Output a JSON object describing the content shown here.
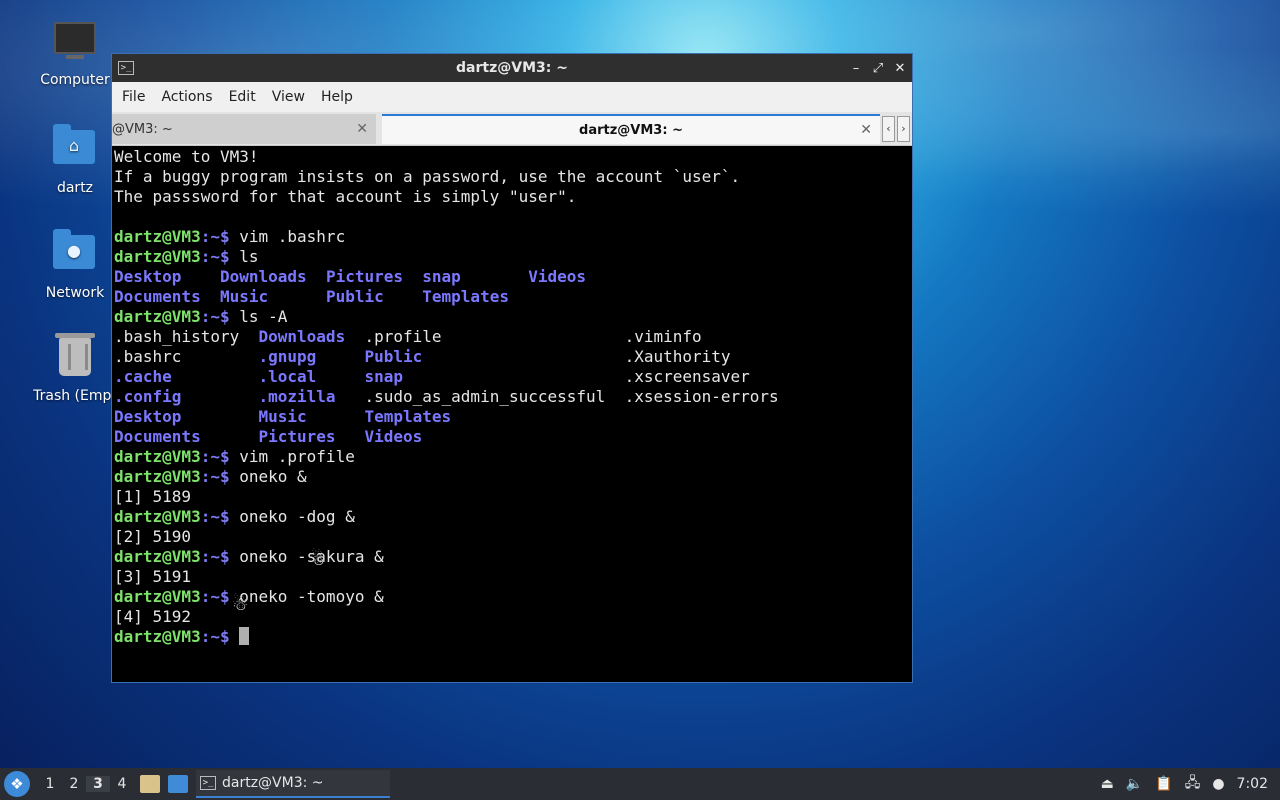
{
  "desktop": {
    "icons": [
      {
        "label": "Computer",
        "icon": "computer-icon"
      },
      {
        "label": "dartz",
        "icon": "home-folder-icon"
      },
      {
        "label": "Network",
        "icon": "network-folder-icon"
      },
      {
        "label": "Trash (Empt",
        "icon": "trash-icon"
      }
    ]
  },
  "window": {
    "title": "dartz@VM3: ~",
    "menu": [
      "File",
      "Actions",
      "Edit",
      "View",
      "Help"
    ],
    "tabs": [
      {
        "label": "@VM3: ~",
        "active": false
      },
      {
        "label": "dartz@VM3: ~",
        "active": true
      }
    ],
    "prompt": "dartz@VM3",
    "prompt_suffix": ":~$ ",
    "welcome": [
      "Welcome to VM3!",
      "If a buggy program insists on a password, use the account `user`.",
      "The passsword for that account is simply \"user\"."
    ],
    "cmd1": "vim .bashrc",
    "cmd2": "ls",
    "ls_row1": [
      "Desktop    ",
      "Downloads  ",
      "Pictures  ",
      "snap       ",
      "Videos"
    ],
    "ls_row2": [
      "Documents  ",
      "Music      ",
      "Public    ",
      "Templates"
    ],
    "cmd3": "ls -A",
    "lsa_rows": [
      [
        ".bash_history  ",
        "Downloads  ",
        ".profile                   ",
        ".viminfo"
      ],
      [
        ".bashrc        ",
        ".gnupg     ",
        "Public                     ",
        ".Xauthority"
      ],
      [
        ".cache         ",
        ".local     ",
        "snap                       ",
        ".xscreensaver"
      ],
      [
        ".config        ",
        ".mozilla   ",
        ".sudo_as_admin_successful  ",
        ".xsession-errors"
      ],
      [
        "Desktop        ",
        "Music      ",
        "Templates"
      ],
      [
        "Documents      ",
        "Pictures   ",
        "Videos"
      ]
    ],
    "cmd4": "vim .profile",
    "cmd5": "oneko &",
    "job1": "[1] 5189",
    "cmd6": "oneko -dog &",
    "job2": "[2] 5190",
    "cmd7": "oneko -sakura &",
    "job3": "[3] 5191",
    "cmd8": "oneko -tomoyo &",
    "job4": "[4] 5192"
  },
  "taskbar": {
    "workspaces": [
      "1",
      "2",
      "3",
      "4"
    ],
    "current_workspace": "3",
    "task_label": "dartz@VM3: ~",
    "clock": "7:02"
  },
  "colors": {
    "prompt": "#7ee36a",
    "directory": "#7b78ff",
    "accent": "#2b7bd4"
  }
}
